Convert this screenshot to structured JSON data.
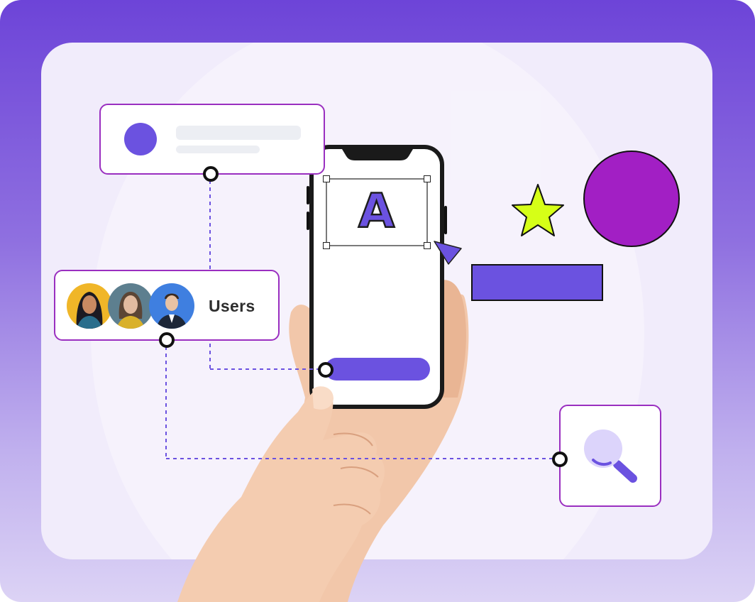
{
  "users_card": {
    "label": "Users"
  },
  "editor": {
    "glyph": "A"
  },
  "colors": {
    "accent_purple": "#6b52e0",
    "card_border": "#9a2fc0",
    "magenta_circle": "#a21fc4",
    "star_lime": "#d6ff17",
    "background": "#6d44d8"
  },
  "icons": [
    "search-icon",
    "cursor-icon",
    "star-icon"
  ]
}
